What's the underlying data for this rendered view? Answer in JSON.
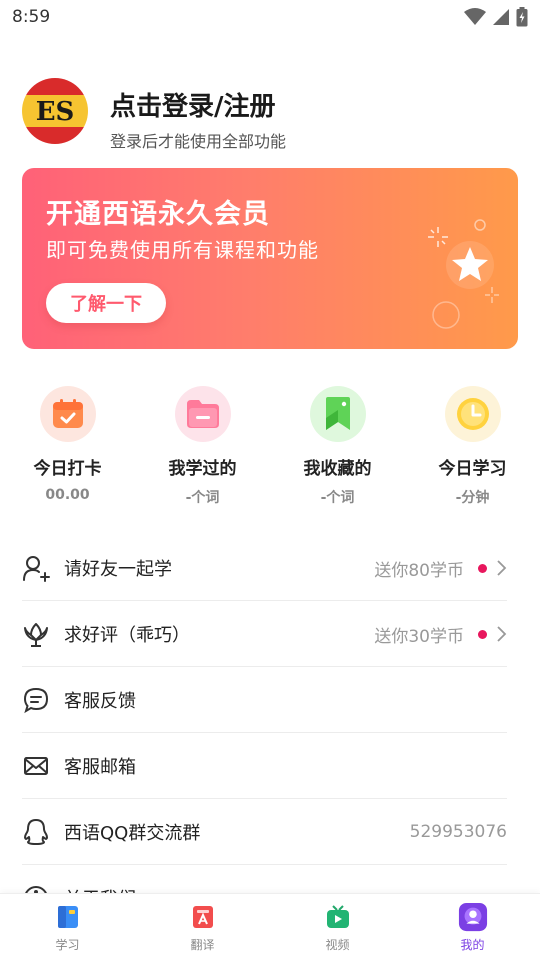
{
  "status_bar": {
    "time": "8:59"
  },
  "profile": {
    "avatar_text": "ES",
    "title": "点击登录/注册",
    "subtitle": "登录后才能使用全部功能"
  },
  "banner": {
    "title": "开通西语永久会员",
    "subtitle": "即可免费使用所有课程和功能",
    "button_label": "了解一下"
  },
  "stats": [
    {
      "label": "今日打卡",
      "value": "00.00",
      "icon": "calendar-check-icon",
      "bg": "#fde6df"
    },
    {
      "label": "我学过的",
      "value": "-个词",
      "icon": "folder-icon",
      "bg": "#fde3ea"
    },
    {
      "label": "我收藏的",
      "value": "-个词",
      "icon": "bookmark-icon",
      "bg": "#dff8dd"
    },
    {
      "label": "今日学习",
      "value": "-分钟",
      "icon": "clock-icon",
      "bg": "#fdf3d8"
    }
  ],
  "menu": [
    {
      "label": "请好友一起学",
      "reward": "送你80学币",
      "icon": "invite-user-icon"
    },
    {
      "label": "求好评（乖巧）",
      "reward": "送你30学币",
      "icon": "flower-icon"
    },
    {
      "label": "客服反馈",
      "icon": "chat-bubble-icon"
    },
    {
      "label": "客服邮箱",
      "icon": "mail-icon"
    },
    {
      "label": "西语QQ群交流群",
      "number": "529953076",
      "icon": "qq-icon"
    },
    {
      "label": "关于我们",
      "icon": "info-icon"
    }
  ],
  "bottom_nav": [
    {
      "label": "学习",
      "icon": "book-icon",
      "active": false
    },
    {
      "label": "翻译",
      "icon": "translate-icon",
      "active": false
    },
    {
      "label": "视频",
      "icon": "tv-icon",
      "active": false
    },
    {
      "label": "我的",
      "icon": "profile-icon",
      "active": true
    }
  ],
  "colors": {
    "accent": "#7b3fe4",
    "dot": "#e8175d",
    "banner_start": "#ff6178",
    "banner_end": "#ff9a4a"
  }
}
